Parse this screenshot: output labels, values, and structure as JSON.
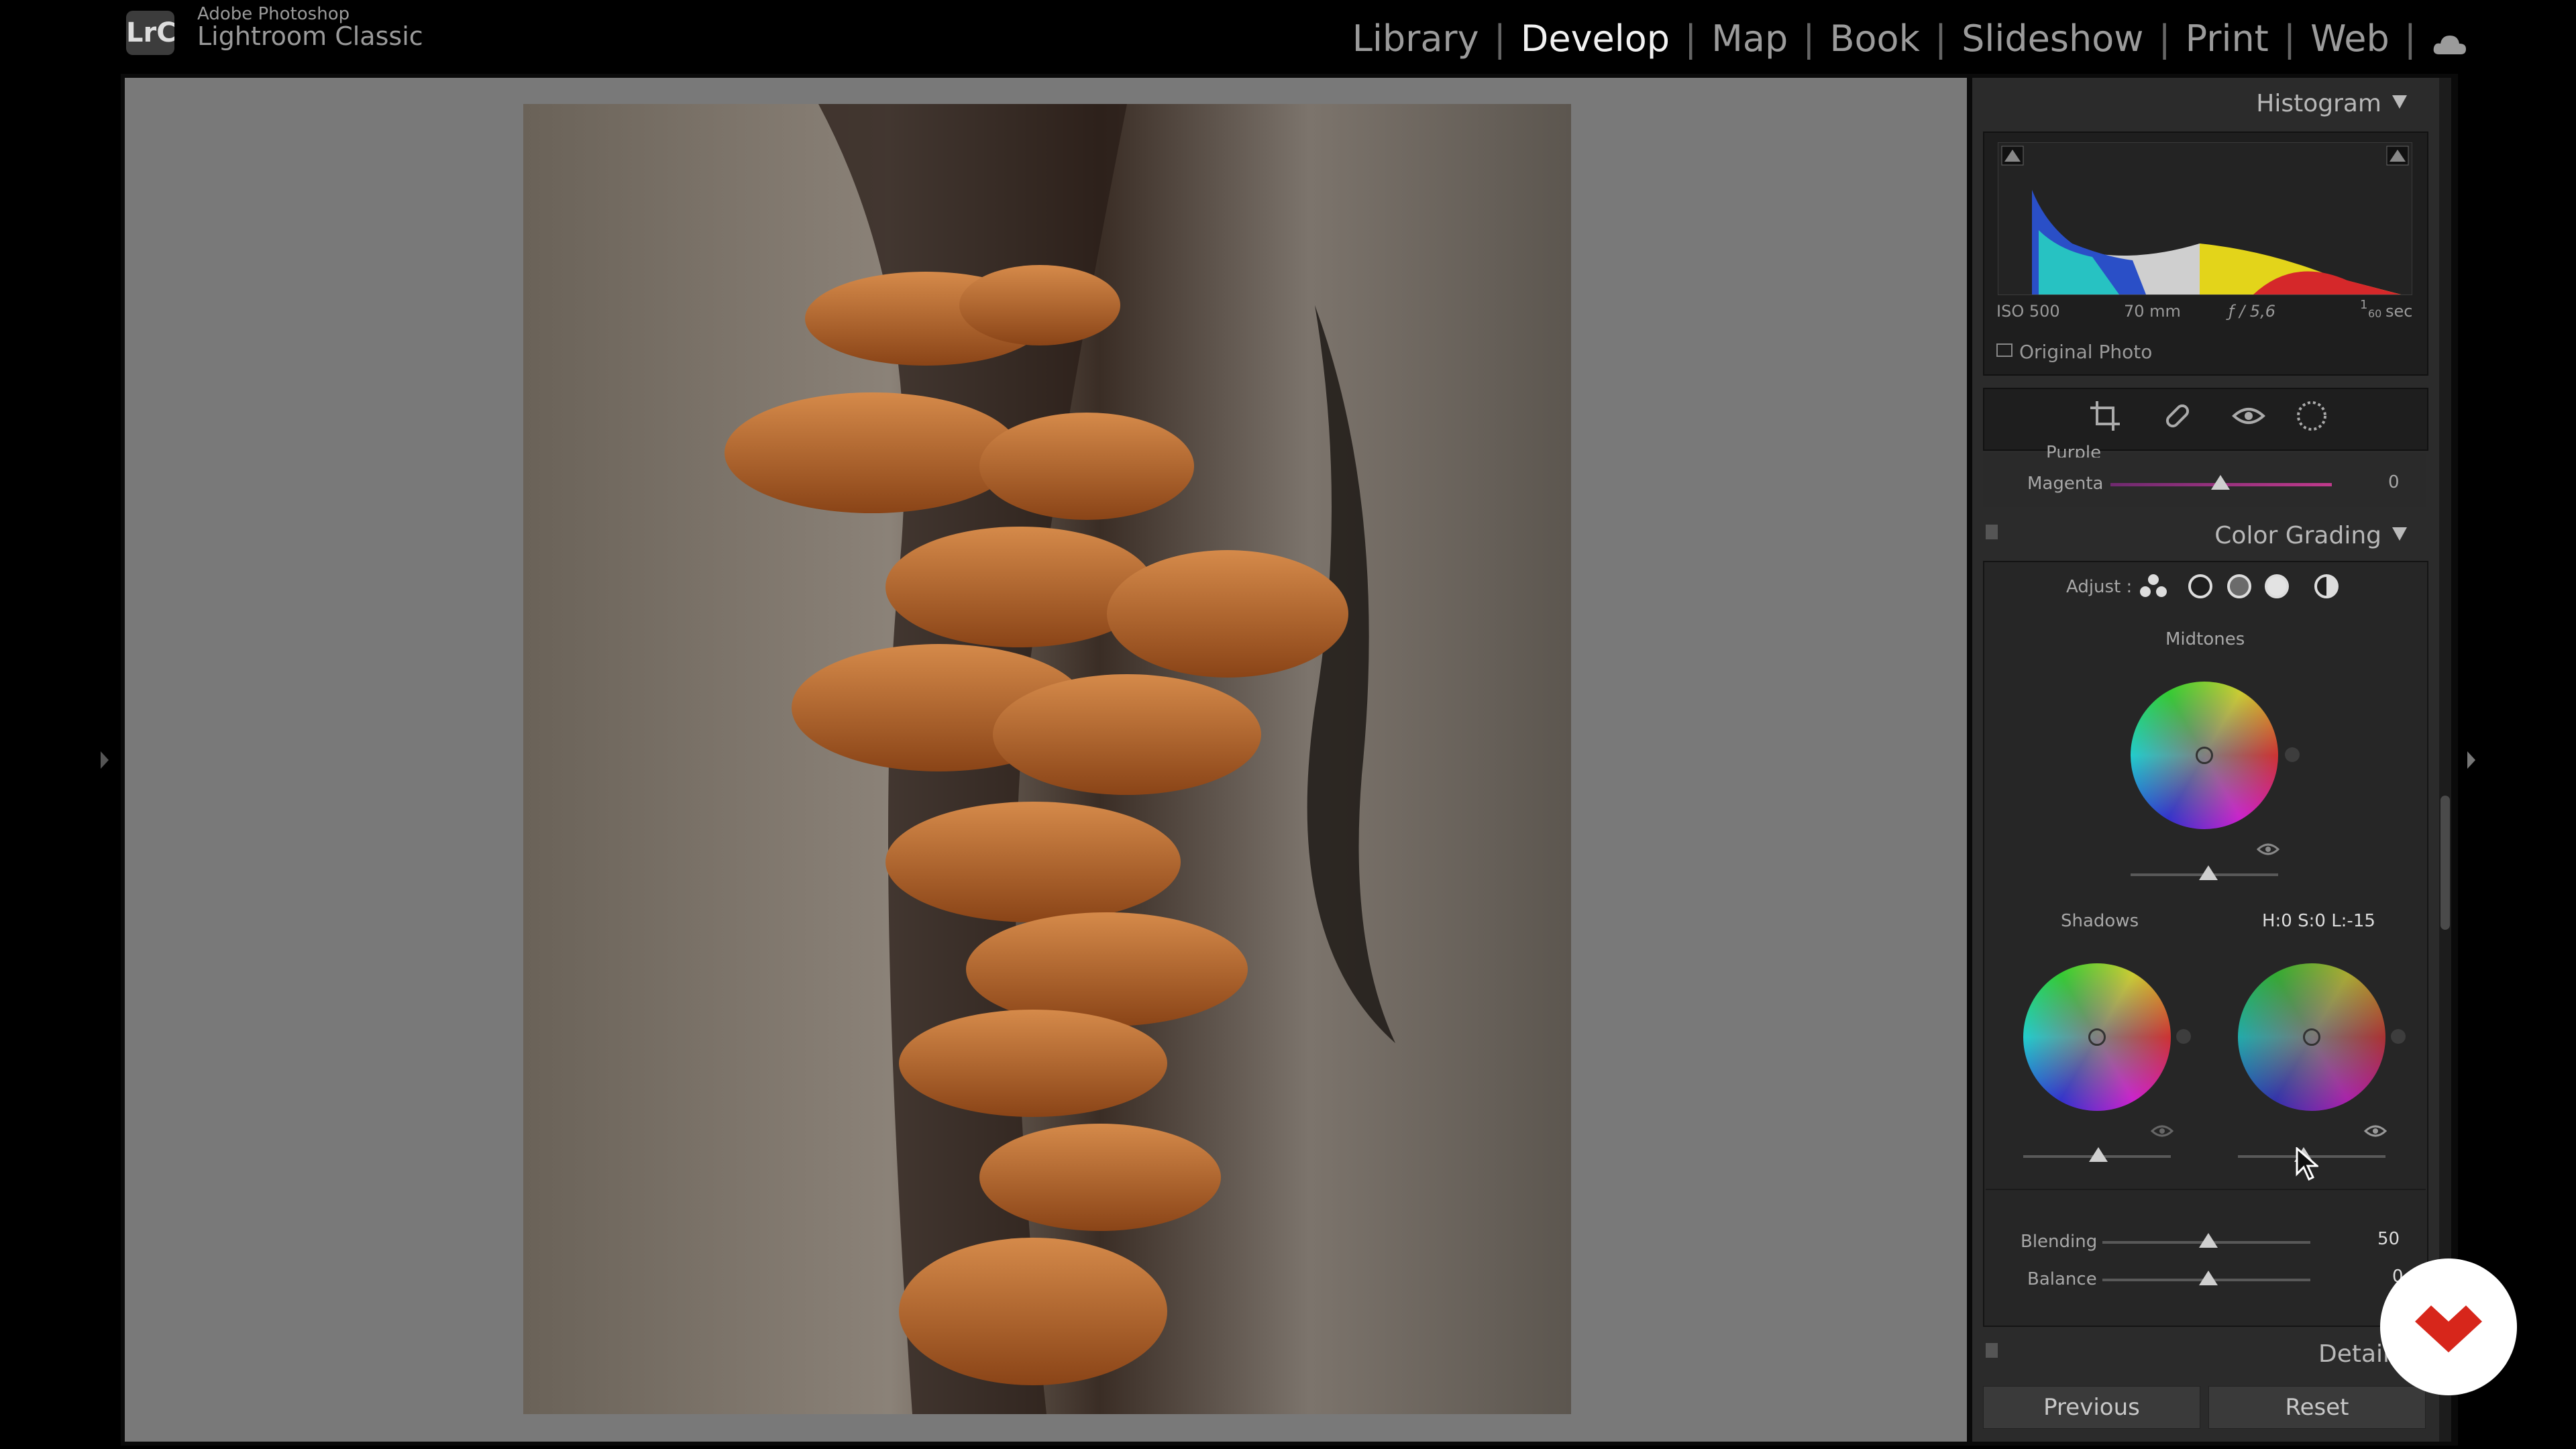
{
  "app": {
    "logo": "LrC",
    "vendor": "Adobe Photoshop",
    "name": "Lightroom Classic"
  },
  "modules": [
    "Library",
    "Develop",
    "Map",
    "Book",
    "Slideshow",
    "Print",
    "Web"
  ],
  "active_module": "Develop",
  "histogram": {
    "title": "Histogram",
    "iso": "ISO 500",
    "focal": "70 mm",
    "aperture": "ƒ / 5,6",
    "shutter_num": "1",
    "shutter_den": "60",
    "shutter_unit": "sec",
    "original_photo": "Original Photo"
  },
  "hsl": {
    "label_partial": "Purple",
    "label": "Magenta",
    "value": "0"
  },
  "color_grading": {
    "title": "Color Grading",
    "adjust": "Adjust :",
    "midtones": "Midtones",
    "shadows": "Shadows",
    "readout": "H:0 S:0 L:-15",
    "blending_label": "Blending",
    "blending_value": "50",
    "balance_label": "Balance",
    "balance_value": "0"
  },
  "detail": {
    "title": "Detail"
  },
  "buttons": {
    "previous": "Previous",
    "reset": "Reset"
  },
  "colors": {
    "accent": "#d7261b",
    "panel": "#2b2b2b",
    "canvas": "#797979"
  }
}
